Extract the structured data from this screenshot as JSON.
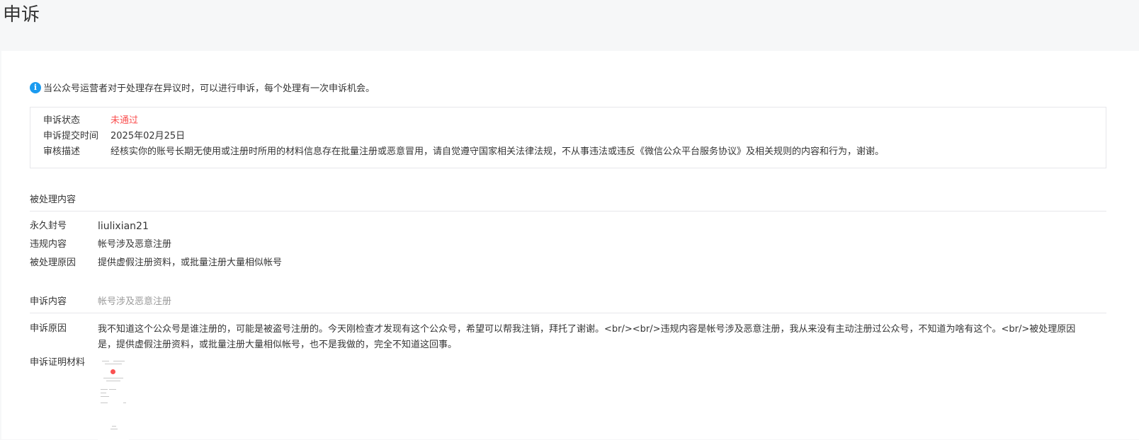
{
  "page": {
    "title": "申诉"
  },
  "tip": {
    "icon": "info-icon",
    "text": "当公众号运营者对于处理存在异议时，可以进行申诉，每个处理有一次申诉机会。"
  },
  "status": {
    "state_label": "申诉状态",
    "state_value": "未通过",
    "submit_label": "申诉提交时间",
    "submit_value": "2025年02月25日",
    "review_label": "审核描述",
    "review_value": "经核实你的账号长期无使用或注册时所用的材料信息存在批量注册或恶意冒用，请自觉遵守国家相关法律法规，不从事违法或违反《微信公众平台服务协议》及相关规则的内容和行为，谢谢。"
  },
  "processed": {
    "heading": "被处理内容",
    "ban_label": "永久封号",
    "ban_value": "liulixian21",
    "violation_label": "违规内容",
    "violation_value": "帐号涉及恶意注册",
    "reason_label": "被处理原因",
    "reason_value": "提供虚假注册资料，或批量注册大量相似帐号"
  },
  "appeal": {
    "heading": "申诉内容",
    "heading_value": "帐号涉及恶意注册",
    "reason_label": "申诉原因",
    "reason_value": "我不知道这个公众号是谁注册的，可能是被盗号注册的。今天刚检查才发现有这个公众号，希望可以帮我注销，拜托了谢谢。<br/><br/>违规内容是帐号涉及恶意注册，我从来没有主动注册过公众号，不知道为啥有这个。<br/>被处理原因是，提供虚假注册资料，或批量注册大量相似帐号，也不是我做的，完全不知道这回事。",
    "proof_label": "申诉证明材料"
  },
  "colors": {
    "fail": "#fa5151",
    "info": "#1b9bf0",
    "muted": "#9a9a9a"
  }
}
